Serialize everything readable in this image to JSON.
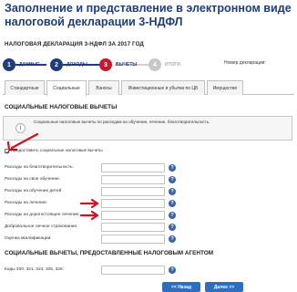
{
  "heading": "Заполнение и представление в электронном виде налоговой декларации 3-НДФЛ",
  "declaration_title": "НАЛОГОВАЯ ДЕКЛАРАЦИЯ 3-НДФЛ ЗА 2017 ГОД",
  "steps": [
    {
      "num": "1",
      "label": "ДАННЫЕ"
    },
    {
      "num": "2",
      "label": "ДОХОДЫ"
    },
    {
      "num": "3",
      "label": "ВЫЧЕТЫ"
    },
    {
      "num": "4",
      "label": "ИТОГИ"
    }
  ],
  "declaration_number_label": "Номер декларации:",
  "tabs": [
    "Стандартные",
    "Социальные",
    "Взносы",
    "Инвестиционные и убытки по ЦБ",
    "Имущество"
  ],
  "active_tab": "Социальные",
  "social_section_title": "СОЦИАЛЬНЫЕ НАЛОГОВЫЕ ВЫЧЕТЫ",
  "info_text": "Социальные налоговые вычеты по расходам на обучение, лечение, благотворительность.",
  "checkbox_label": "Предоставить социальные налоговые вычеты",
  "checkbox_checked": true,
  "rows": [
    {
      "label": "Расходы на благотворительность:",
      "value": ""
    },
    {
      "label": "Расходы на свое обучение:",
      "value": ""
    },
    {
      "label": "Расходы на обучение детей",
      "value": ""
    },
    {
      "label": "Расходы на лечение:",
      "value": ""
    },
    {
      "label": "Расходы на дорогостоящее лечение:",
      "value": ""
    },
    {
      "label": "Добровольное личное страхование:",
      "value": ""
    },
    {
      "label": "Оценка квалификации:",
      "value": ""
    }
  ],
  "agent_section_title": "СОЦИАЛЬНЫЕ ВЫЧЕТЫ, ПРЕДОСТАВЛЕННЫЕ НАЛОГОВЫМ АГЕНТОМ",
  "codes_label": "Коды 320, 321, 324, 325, 326:",
  "buttons": {
    "back": "<< Назад",
    "next": "Далее >>"
  },
  "colors": {
    "primary": "#1f3d7a",
    "current_step": "#c8192f",
    "annotation_arrow": "#d01222",
    "button": "#2d6ec0"
  },
  "icons": {
    "info": "info-icon",
    "help": "question-icon",
    "annotation": "red-arrow-icon"
  }
}
